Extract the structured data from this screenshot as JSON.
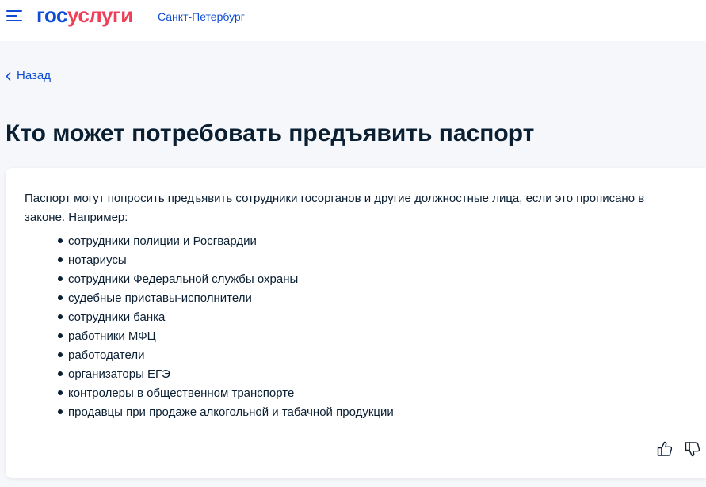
{
  "header": {
    "logo_part1": "гос",
    "logo_part2": "услуги",
    "region": "Санкт-Петербург"
  },
  "nav": {
    "back_label": "Назад"
  },
  "page": {
    "title": "Кто может потребовать предъявить паспорт"
  },
  "content": {
    "intro": "Паспорт могут попросить предъявить сотрудники госорганов и другие должностные лица, если это прописано в законе. Например:",
    "items": [
      "сотрудники полиции и Росгвардии",
      "нотариусы",
      "сотрудники Федеральной службы охраны",
      "судебные приставы-исполнители",
      "сотрудники банка",
      "работники МФЦ",
      "работодатели",
      "организаторы ЕГЭ",
      "контролеры в общественном транспорте",
      "продавцы при продаже алкогольной и табачной продукции"
    ]
  },
  "icons": {
    "menu": "menu-icon",
    "back": "chevron-left-icon",
    "like": "thumbs-up-icon",
    "dislike": "thumbs-down-icon"
  },
  "colors": {
    "brand_blue": "#0d4cd3",
    "brand_red": "#ee3f58",
    "text": "#0b1f33",
    "background": "#f5f7fa",
    "card": "#ffffff"
  }
}
